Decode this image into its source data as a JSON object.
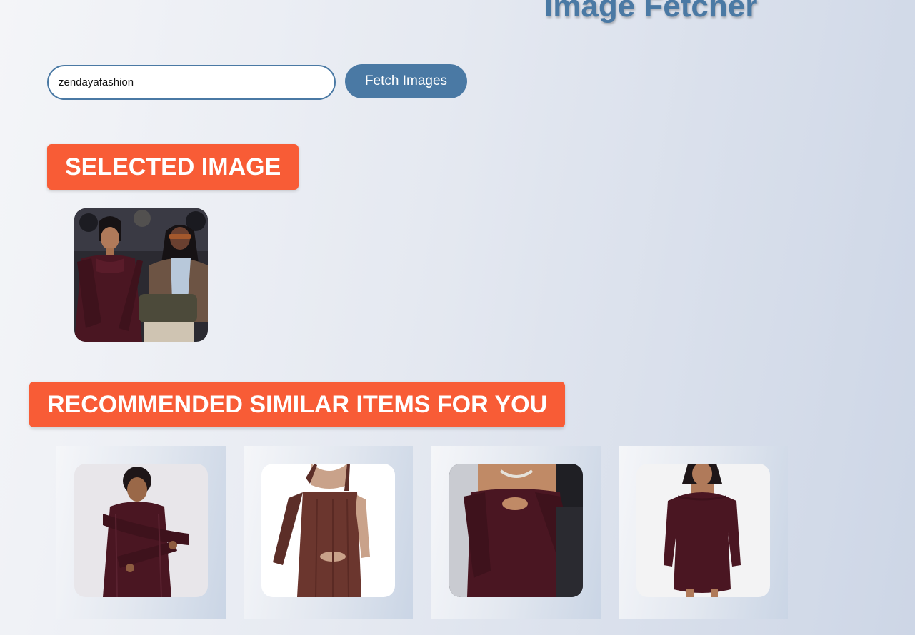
{
  "app": {
    "title": "Image Fetcher"
  },
  "search": {
    "value": "zendayafashion",
    "button_label": "Fetch Images"
  },
  "selected": {
    "heading": "SELECTED IMAGE",
    "image": {
      "description": "two-people-seated-front-row"
    }
  },
  "recommended": {
    "heading": "RECOMMENDED SIMILAR ITEMS FOR YOU",
    "items": [
      {
        "description": "burgundy-knit-wrap-top-skirt"
      },
      {
        "description": "brown-halter-knit-dress"
      },
      {
        "description": "burgundy-off-shoulder-dress"
      },
      {
        "description": "burgundy-sweetheart-bodycon-dress"
      }
    ]
  },
  "colors": {
    "accent": "#f85c36",
    "primary": "#4a79a4",
    "garment": "#4a1622"
  }
}
